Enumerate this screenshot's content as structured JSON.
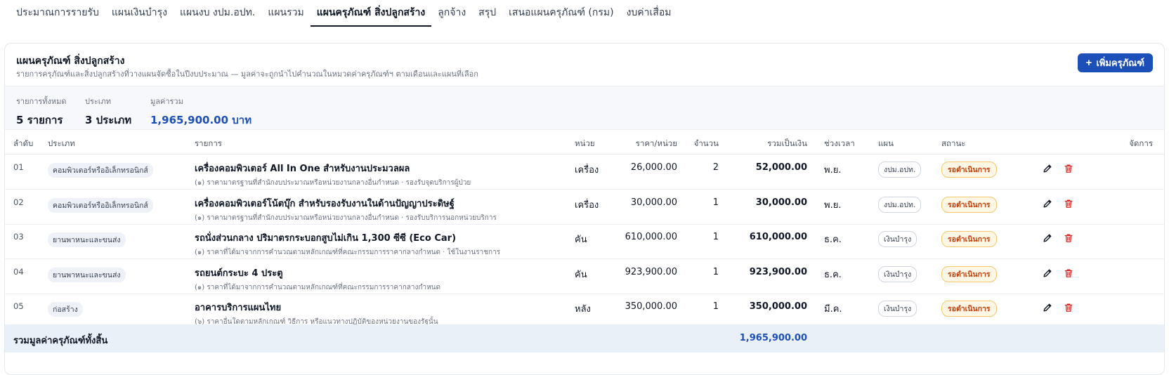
{
  "tabs": [
    {
      "label": "ประมาณการรายรับ",
      "active": false
    },
    {
      "label": "แผนเงินบำรุง",
      "active": false
    },
    {
      "label": "แผนงบ งปม.อปท.",
      "active": false
    },
    {
      "label": "แผนรวม",
      "active": false
    },
    {
      "label": "แผนครุภัณฑ์ สิ่งปลูกสร้าง",
      "active": true
    },
    {
      "label": "ลูกจ้าง",
      "active": false
    },
    {
      "label": "สรุป",
      "active": false
    },
    {
      "label": "เสนอแผนครุภัณฑ์ (กรม)",
      "active": false
    },
    {
      "label": "งบค่าเสื่อม",
      "active": false
    }
  ],
  "card": {
    "title": "แผนครุภัณฑ์ สิ่งปลูกสร้าง",
    "subtitle": "รายการครุภัณฑ์และสิ่งปลูกสร้างที่วางแผนจัดซื้อในปีงบประมาณ — มูลค่าจะถูกนำไปคำนวณในหมวดค่าครุภัณฑ์ฯ ตามเดือนและแผนที่เลือก",
    "add_label": "เพิ่มครุภัณฑ์"
  },
  "stats": {
    "total_label": "รายการทั้งหมด",
    "total_value": "5 รายการ",
    "type_label": "ประเภท",
    "type_value": "3 ประเภท",
    "sum_label": "มูลค่ารวม",
    "sum_value": "1,965,900.00 บาท"
  },
  "table": {
    "headers": {
      "idx": "ลำดับ",
      "type": "ประเภท",
      "item": "รายการ",
      "unit": "หน่วย",
      "price": "ราคา/หน่วย",
      "qty": "จำนวน",
      "total": "รวมเป็นเงิน",
      "period": "ช่วงเวลา",
      "plan": "แผน",
      "status": "สถานะ",
      "actions": "จัดการ"
    },
    "rows": [
      {
        "idx": "01",
        "type": "คอมพิวเตอร์หรืออิเล็กทรอนิกส์",
        "title": "เครื่องคอมพิวเตอร์ All In One สำหรับงานประมวลผล",
        "desc": "(๑) ราคามาตรฐานที่สำนักงบประมาณหรือหน่วยงานกลางอื่นกำหนด · รองรับจุดบริการผู้ป่วย",
        "unit": "เครื่อง",
        "price": "26,000.00",
        "qty": "2",
        "total": "52,000.00",
        "period": "พ.ย.",
        "plan": "งปม.อปท.",
        "status": "รอดำเนินการ"
      },
      {
        "idx": "02",
        "type": "คอมพิวเตอร์หรืออิเล็กทรอนิกส์",
        "title": "เครื่องคอมพิวเตอร์โน้ตบุ๊ก สำหรับรองรับงานในด้านปัญญาประดิษฐ์",
        "desc": "(๑) ราคามาตรฐานที่สำนักงบประมาณหรือหน่วยงานกลางอื่นกำหนด · รองรับบริการนอกหน่วยบริการ",
        "unit": "เครื่อง",
        "price": "30,000.00",
        "qty": "1",
        "total": "30,000.00",
        "period": "พ.ย.",
        "plan": "งปม.อปท.",
        "status": "รอดำเนินการ"
      },
      {
        "idx": "03",
        "type": "ยานพาหนะและขนส่ง",
        "title": "รถนั่งส่วนกลาง ปริมาตรกระบอกสูบไม่เกิน 1,300 ซีซี (Eco Car)",
        "desc": "(๑) ราคาที่ได้มาจากการคำนวณตามหลักเกณฑ์ที่คณะกรรมการราคากลางกำหนด · ใช้ในงานราชการ",
        "unit": "คัน",
        "price": "610,000.00",
        "qty": "1",
        "total": "610,000.00",
        "period": "ธ.ค.",
        "plan": "เงินบำรุง",
        "status": "รอดำเนินการ"
      },
      {
        "idx": "04",
        "type": "ยานพาหนะและขนส่ง",
        "title": "รถยนต์กระบะ 4 ประตู",
        "desc": "(๑) ราคาที่ได้มาจากการคำนวณตามหลักเกณฑ์ที่คณะกรรมการราคากลางกำหนด",
        "unit": "คัน",
        "price": "923,900.00",
        "qty": "1",
        "total": "923,900.00",
        "period": "ธ.ค.",
        "plan": "เงินบำรุง",
        "status": "รอดำเนินการ"
      },
      {
        "idx": "05",
        "type": "ก่อสร้าง",
        "title": "อาคารบริการแผนไทย",
        "desc": "(๖) ราคาอื่นใดตามหลักเกณฑ์ วิธีการ หรือแนวทางปฏิบัติของหน่วยงานของรัฐนั้น",
        "unit": "หลัง",
        "price": "350,000.00",
        "qty": "1",
        "total": "350,000.00",
        "period": "มี.ค.",
        "plan": "เงินบำรุง",
        "status": "รอดำเนินการ"
      }
    ],
    "footer_label": "รวมมูลค่าครุภัณฑ์ทั้งสิ้น",
    "footer_total": "1,965,900.00"
  },
  "icons": {
    "add": "plus-icon",
    "edit": "pencil-icon",
    "delete": "trash-icon"
  },
  "colors": {
    "accent": "#1d4fb8",
    "status_text": "#c2410c",
    "status_bg": "#fff7e6",
    "delete": "#dc2626"
  }
}
